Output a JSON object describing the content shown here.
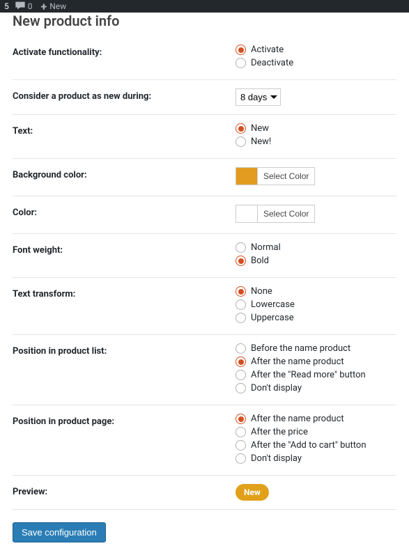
{
  "adminBar": {
    "count5": "5",
    "comments": "0",
    "newLabel": "New"
  },
  "pageTitle": "New product info",
  "settings": {
    "activateFunctionality": {
      "label": "Activate functionality:",
      "options": [
        {
          "label": "Activate",
          "checked": true
        },
        {
          "label": "Deactivate",
          "checked": false
        }
      ]
    },
    "considerNew": {
      "label": "Consider a product as new during:",
      "selected": "8 days"
    },
    "text": {
      "label": "Text:",
      "options": [
        {
          "label": "New",
          "checked": true
        },
        {
          "label": "New!",
          "checked": false
        }
      ]
    },
    "backgroundColor": {
      "label": "Background color:",
      "swatchColor": "#e29b1f",
      "buttonLabel": "Select Color"
    },
    "color": {
      "label": "Color:",
      "swatchColor": "#ffffff",
      "buttonLabel": "Select Color"
    },
    "fontWeight": {
      "label": "Font weight:",
      "options": [
        {
          "label": "Normal",
          "checked": false
        },
        {
          "label": "Bold",
          "checked": true
        }
      ]
    },
    "textTransform": {
      "label": "Text transform:",
      "options": [
        {
          "label": "None",
          "checked": true
        },
        {
          "label": "Lowercase",
          "checked": false
        },
        {
          "label": "Uppercase",
          "checked": false
        }
      ]
    },
    "positionList": {
      "label": "Position in product list:",
      "options": [
        {
          "label": "Before the name product",
          "checked": false
        },
        {
          "label": "After the name product",
          "checked": true
        },
        {
          "label": "After the \"Read more\" button",
          "checked": false
        },
        {
          "label": "Don't display",
          "checked": false
        }
      ]
    },
    "positionPage": {
      "label": "Position in product page:",
      "options": [
        {
          "label": "After the name product",
          "checked": true
        },
        {
          "label": "After the price",
          "checked": false
        },
        {
          "label": "After the \"Add to cart\" button",
          "checked": false
        },
        {
          "label": "Don't display",
          "checked": false
        }
      ]
    },
    "preview": {
      "label": "Preview:",
      "badgeText": "New"
    }
  },
  "saveButton": "Save configuration"
}
